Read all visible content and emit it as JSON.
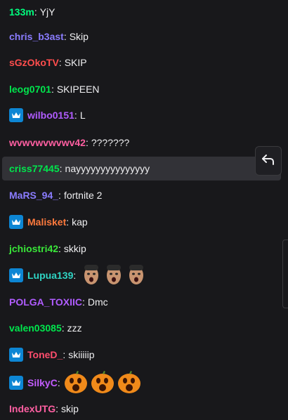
{
  "messages": [
    {
      "user": "133m",
      "color": "#00ff7f",
      "text": "YjY",
      "badge": false
    },
    {
      "user": "chris_b3ast",
      "color": "#8a7cff",
      "text": "Skip",
      "badge": false
    },
    {
      "user": "sGzOkoTV",
      "color": "#ff4d4d",
      "text": "SKIP",
      "badge": false
    },
    {
      "user": "leog0701",
      "color": "#00e64d",
      "text": "SKIPEEN",
      "badge": false
    },
    {
      "user": "wilbo0151",
      "color": "#b05cff",
      "text": "L",
      "badge": true
    },
    {
      "user": "wvwvwvwvwv42",
      "color": "#ff5fa2",
      "text": "???????",
      "badge": false
    },
    {
      "user": "criss77445",
      "color": "#00e64d",
      "text": "nayyyyyyyyyyyyyyy",
      "badge": false,
      "highlighted": true
    },
    {
      "user": "MaRS_94_",
      "color": "#8a7cff",
      "text": "fortnite 2",
      "badge": false
    },
    {
      "user": "Malisket",
      "color": "#ff7a3d",
      "text": "kap",
      "badge": true
    },
    {
      "user": "jchiostri42",
      "color": "#39e639",
      "text": "skkip",
      "badge": false
    },
    {
      "user": "Lupua139",
      "color": "#2fd4c4",
      "text": "",
      "badge": true,
      "emotes": [
        "face-emote",
        "face-emote",
        "face-emote"
      ]
    },
    {
      "user": "POLGA_TOXIIC",
      "color": "#b05cff",
      "text": "Dmc",
      "badge": false
    },
    {
      "user": "valen03085",
      "color": "#00e64d",
      "text": "zzz",
      "badge": false
    },
    {
      "user": "ToneD_",
      "color": "#ff4d6d",
      "text": "skiiiiip",
      "badge": true
    },
    {
      "user": "SilkyC",
      "color": "#c35cff",
      "text": "",
      "badge": true,
      "emotes": [
        "pumpkin-emote",
        "pumpkin-emote",
        "pumpkin-emote"
      ]
    },
    {
      "user": "IndexUTG",
      "color": "#ff5fa2",
      "text": "skip",
      "badge": false
    }
  ],
  "icons": {
    "badge": "crown-icon",
    "reply": "reply-arrow-icon"
  },
  "colors": {
    "background": "#18181b",
    "badge": "#0d86d4",
    "highlight": "#323237"
  }
}
